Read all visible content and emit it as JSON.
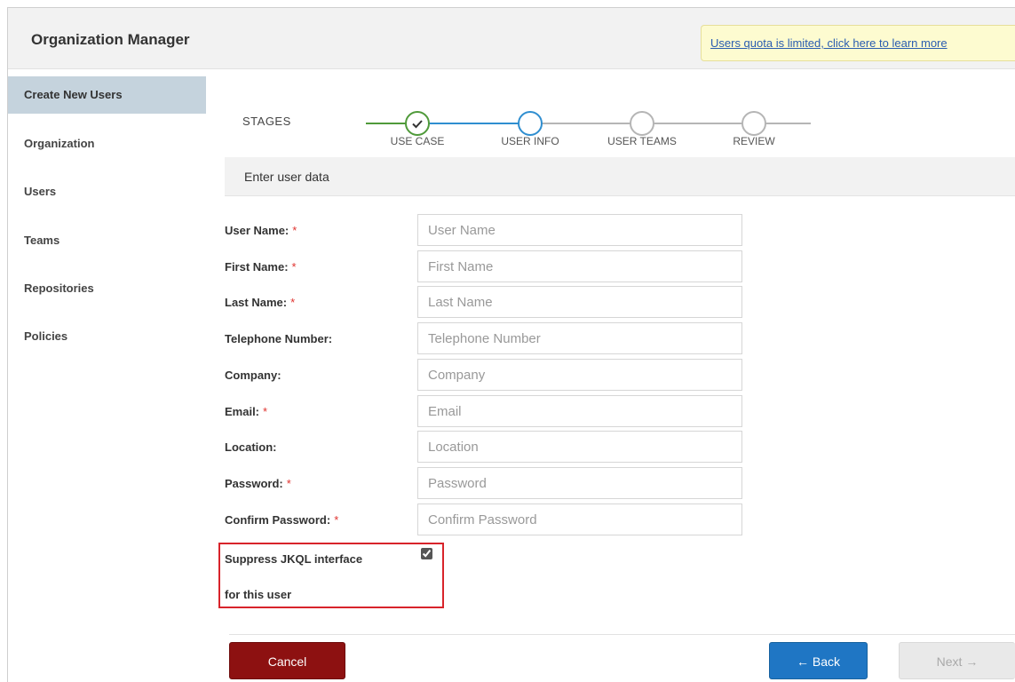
{
  "app": {
    "title": "Organization Manager",
    "quota_banner": "Users quota is limited, click here to learn more"
  },
  "sidebar": {
    "items": [
      {
        "label": "Create New Users",
        "active": true
      },
      {
        "label": "Organization",
        "active": false
      },
      {
        "label": "Users",
        "active": false
      },
      {
        "label": "Teams",
        "active": false
      },
      {
        "label": "Repositories",
        "active": false
      },
      {
        "label": "Policies",
        "active": false
      }
    ]
  },
  "stages": {
    "label": "STAGES",
    "steps": [
      {
        "label": "USE CASE",
        "state": "done"
      },
      {
        "label": "USER INFO",
        "state": "current"
      },
      {
        "label": "USER TEAMS",
        "state": "pending"
      },
      {
        "label": "REVIEW",
        "state": "pending"
      }
    ]
  },
  "section": {
    "title": "Enter user data"
  },
  "form": {
    "fields": [
      {
        "label": "User Name:",
        "required": true,
        "placeholder": "User Name",
        "value": ""
      },
      {
        "label": "First Name:",
        "required": true,
        "placeholder": "First Name",
        "value": ""
      },
      {
        "label": "Last Name:",
        "required": true,
        "placeholder": "Last Name",
        "value": ""
      },
      {
        "label": "Telephone Number:",
        "required": false,
        "placeholder": "Telephone Number",
        "value": ""
      },
      {
        "label": "Company:",
        "required": false,
        "placeholder": "Company",
        "value": ""
      },
      {
        "label": "Email:",
        "required": true,
        "placeholder": "Email",
        "value": ""
      },
      {
        "label": "Location:",
        "required": false,
        "placeholder": "Location",
        "value": ""
      },
      {
        "label": "Password:",
        "required": true,
        "placeholder": "Password",
        "value": ""
      },
      {
        "label": "Confirm Password:",
        "required": true,
        "placeholder": "Confirm Password",
        "value": ""
      }
    ],
    "required_mark": "*",
    "suppress": {
      "line1": "Suppress JKQL interface",
      "line2": "for this user",
      "checked": true
    }
  },
  "buttons": {
    "cancel": "Cancel",
    "back": "← Back",
    "next": "Next →"
  },
  "colors": {
    "done": "#4f9a3a",
    "current": "#2f8ed0",
    "pending": "#b5b5b5",
    "highlight": "#d8242b"
  }
}
